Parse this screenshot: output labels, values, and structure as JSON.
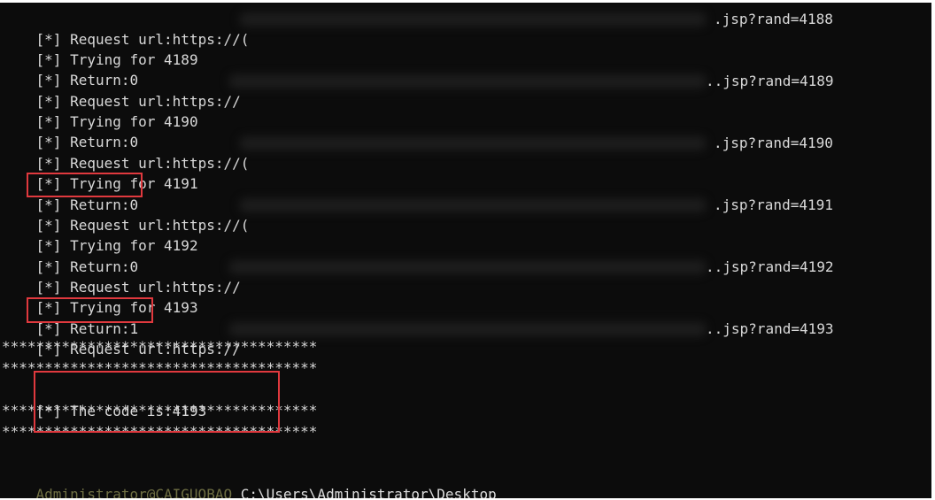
{
  "terminal": {
    "lines": [
      {
        "mark": "[*]",
        "text": "Request url:https://(",
        "suffix": ".jsp?rand=4188"
      },
      {
        "mark": "[*]",
        "text": "Trying for 4189"
      },
      {
        "mark": "[*]",
        "text": "Return:0"
      },
      {
        "mark": "[*]",
        "text": "Request url:https://",
        "suffix": ".jsp?rand=4189"
      },
      {
        "mark": "[*]",
        "text": "Trying for 4190"
      },
      {
        "mark": "[*]",
        "text": "Return:0"
      },
      {
        "mark": "[*]",
        "text": "Request url:https://(",
        "suffix": ".jsp?rand=4190"
      },
      {
        "mark": "[*]",
        "text": "Trying for 4191"
      },
      {
        "mark": "[*]",
        "text": "Return:0"
      },
      {
        "mark": "[*]",
        "text": "Request url:https://(",
        "suffix": ".jsp?rand=4191"
      },
      {
        "mark": "[*]",
        "text": "Trying for 4192"
      },
      {
        "mark": "[*]",
        "text": "Return:0"
      },
      {
        "mark": "[*]",
        "text": "Request url:https://",
        "suffix": ".jsp?rand=4192"
      },
      {
        "mark": "[*]",
        "text": "Trying for 4193"
      },
      {
        "mark": "[*]",
        "text": "Return:1"
      },
      {
        "mark": "[*]",
        "text": "Request url:https://",
        "suffix": ".jsp?rand=4193"
      }
    ],
    "stars": "*************************************",
    "result": {
      "mark": "[*]",
      "text": "The code is:4193"
    },
    "prompt": {
      "user": "Administrator@CAIGUOBAO",
      "path": "C:\\Users\\Administrator\\Desktop",
      "caret": ">"
    },
    "colors": {
      "background": "#0c0c0c",
      "text": "#d9d9d9",
      "highlight": "#e0393e",
      "prompt_user": "#6f6f43"
    }
  }
}
